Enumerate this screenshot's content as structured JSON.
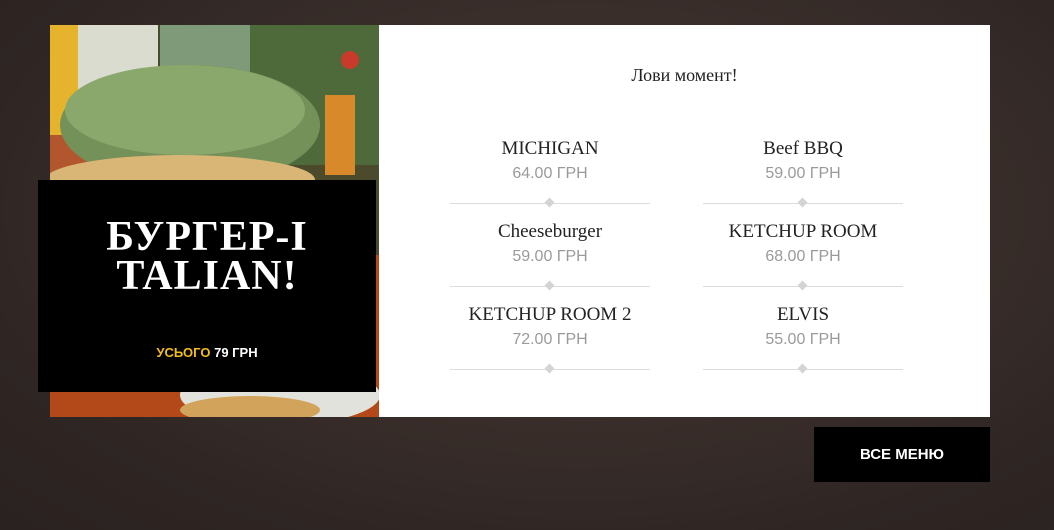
{
  "promo": {
    "title": "БУРГЕР-ITALIAN!",
    "total_label": "УСЬОГО",
    "total_value": "79 ГРН"
  },
  "menu": {
    "heading": "Лови момент!",
    "items": [
      {
        "name": "MICHIGAN",
        "price": "64.00 ГРН"
      },
      {
        "name": "Beef BBQ",
        "price": "59.00 ГРН"
      },
      {
        "name": "Cheeseburger",
        "price": "59.00 ГРН"
      },
      {
        "name": "KETCHUP ROOM",
        "price": "68.00 ГРН"
      },
      {
        "name": "KETCHUP ROOM 2",
        "price": "72.00 ГРН"
      },
      {
        "name": "ELVIS",
        "price": "55.00 ГРН"
      }
    ]
  },
  "actions": {
    "all_menu_label": "ВСЕ МЕНЮ"
  },
  "colors": {
    "accent": "#f3bd1d",
    "price_gray": "#9a9a9a"
  }
}
